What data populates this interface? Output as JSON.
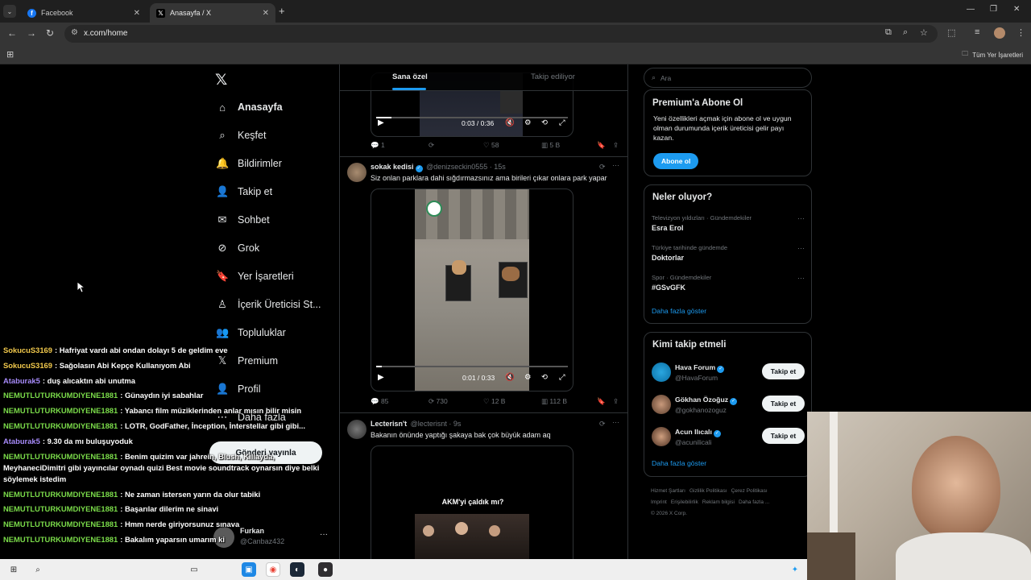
{
  "browser": {
    "tabs": [
      {
        "title": "Facebook",
        "favicon": "facebook-icon",
        "active": false
      },
      {
        "title": "Anasayfa / X",
        "favicon": "x-icon",
        "active": true
      }
    ],
    "url": "x.com/home",
    "bookmarks_all": "Tüm Yer İşaretleri"
  },
  "nav": {
    "items": [
      {
        "label": "Anasayfa",
        "icon": "home-icon"
      },
      {
        "label": "Keşfet",
        "icon": "search-icon"
      },
      {
        "label": "Bildirimler",
        "icon": "bell-icon"
      },
      {
        "label": "Takip et",
        "icon": "person-add-icon"
      },
      {
        "label": "Sohbet",
        "icon": "mail-icon"
      },
      {
        "label": "Grok",
        "icon": "grok-icon"
      },
      {
        "label": "Yer İşaretleri",
        "icon": "bookmark-icon"
      },
      {
        "label": "İçerik Üreticisi St...",
        "icon": "creator-icon"
      },
      {
        "label": "Topluluklar",
        "icon": "communities-icon"
      },
      {
        "label": "Premium",
        "icon": "x-icon"
      },
      {
        "label": "Profil",
        "icon": "profile-icon"
      },
      {
        "label": "Daha fazla",
        "icon": "more-icon"
      }
    ],
    "post_button": "Gönderi yayınla",
    "account": {
      "name": "Furkan",
      "handle": "@Canbaz432"
    }
  },
  "chat": [
    {
      "user": "SokucuS3169",
      "color": "#f2c94c",
      "msg": ": Hafriyat vardı abi ondan dolayı 5 de geldim eve"
    },
    {
      "user": "SokucuS3169",
      "color": "#f2c94c",
      "msg": ": Sağolasın Abi Kepçe Kullanıyom Abi"
    },
    {
      "user": "Ataburak5",
      "color": "#a78bfa",
      "msg": ": duş alıcaktın abi unutma"
    },
    {
      "user": "NEMUTLUTURKUMDIYENE1881",
      "color": "#7bdc4a",
      "msg": ": Günaydın iyi sabahlar"
    },
    {
      "user": "NEMUTLUTURKUMDIYENE1881",
      "color": "#7bdc4a",
      "msg": ": Yabancı film müziklerinden anlar mısın bilir misin"
    },
    {
      "user": "NEMUTLUTURKUMDIYENE1881",
      "color": "#7bdc4a",
      "msg": ": LOTR, GodFather, İnception, İnterstellar gibi gibi..."
    },
    {
      "user": "Ataburak5",
      "color": "#a78bfa",
      "msg": ": 9.30 da mı buluşuyoduk"
    },
    {
      "user": "NEMUTLUTURKUMDIYENE1881",
      "color": "#7bdc4a",
      "msg": ": Benim quizim var jahrein, Blush, Killayda, MeyhaneciDimitri gibi yayıncılar oynadı quizi Best movie soundtrack oynarsın diye belki söylemek istedim"
    },
    {
      "user": "NEMUTLUTURKUMDIYENE1881",
      "color": "#7bdc4a",
      "msg": ": Ne zaman istersen yarın da olur tabiki"
    },
    {
      "user": "NEMUTLUTURKUMDIYENE1881",
      "color": "#7bdc4a",
      "msg": ": Başarılar dilerim ne sinavi"
    },
    {
      "user": "NEMUTLUTURKUMDIYENE1881",
      "color": "#7bdc4a",
      "msg": ": Hmm nerde giriyorsunuz sınava"
    },
    {
      "user": "NEMUTLUTURKUMDIYENE1881",
      "color": "#7bdc4a",
      "msg": ": Bakalım yaparsın umarım ki"
    }
  ],
  "feed": {
    "tabs": [
      "Sana özel",
      "Takip ediliyor"
    ],
    "tweet0": {
      "video_time": "0:03 / 0:36",
      "progress": 0.08,
      "stats": {
        "reply": "1",
        "retweet": "",
        "like": "58",
        "views": "5 B"
      }
    },
    "tweet1": {
      "name": "sokak kedisi",
      "handle": "@denizseckin0555 · 15s",
      "text": "Siz onlan parklara dahi sığdırmazsınız ama birileri çıkar onlara park yapar",
      "video_time": "0:01 / 0:33",
      "progress": 0.03,
      "stats": {
        "reply": "85",
        "retweet": "730",
        "like": "12 B",
        "views": "112 B"
      }
    },
    "tweet2": {
      "name": "Lecterisn't",
      "handle": "@lecterisnt · 9s",
      "text": "Bakanın önünde yaptığı şakaya bak çok büyük adam aq",
      "caption": "AKM'yi çaldık mı?"
    }
  },
  "sidebar": {
    "search_placeholder": "Ara",
    "premium": {
      "title": "Premium'a Abone Ol",
      "desc": "Yeni özellikleri açmak için abone ol ve uygun olman durumunda içerik üreticisi gelir payı kazan.",
      "button": "Abone ol"
    },
    "trends": {
      "title": "Neler oluyor?",
      "items": [
        {
          "meta": "Televizyon yıldızları · Gündemdekiler",
          "name": "Esra Erol"
        },
        {
          "meta": "Türkiye tarihinde gündemde",
          "name": "Doktorlar"
        },
        {
          "meta": "Spor · Gündemdekiler",
          "name": "#GSvGFK"
        }
      ],
      "show_more": "Daha fazla göster"
    },
    "who": {
      "title": "Kimi takip etmeli",
      "items": [
        {
          "name": "Hava Forum",
          "handle": "@HavaForum",
          "button": "Takip et"
        },
        {
          "name": "Gökhan Özoğuz",
          "handle": "@gokhanozoguz",
          "button": "Takip et"
        },
        {
          "name": "Acun Ilıcalı",
          "handle": "@acunilicali",
          "button": "Takip et"
        }
      ],
      "show_more": "Daha fazla göster"
    },
    "footer": [
      "Hizmet Şartları",
      "Gizlilik Politikası",
      "Çerez Politikası",
      "Imprint",
      "Erişilebilirlik",
      "Reklam bilgisi",
      "Daha fazla ...",
      "© 2026 X Corp."
    ]
  }
}
